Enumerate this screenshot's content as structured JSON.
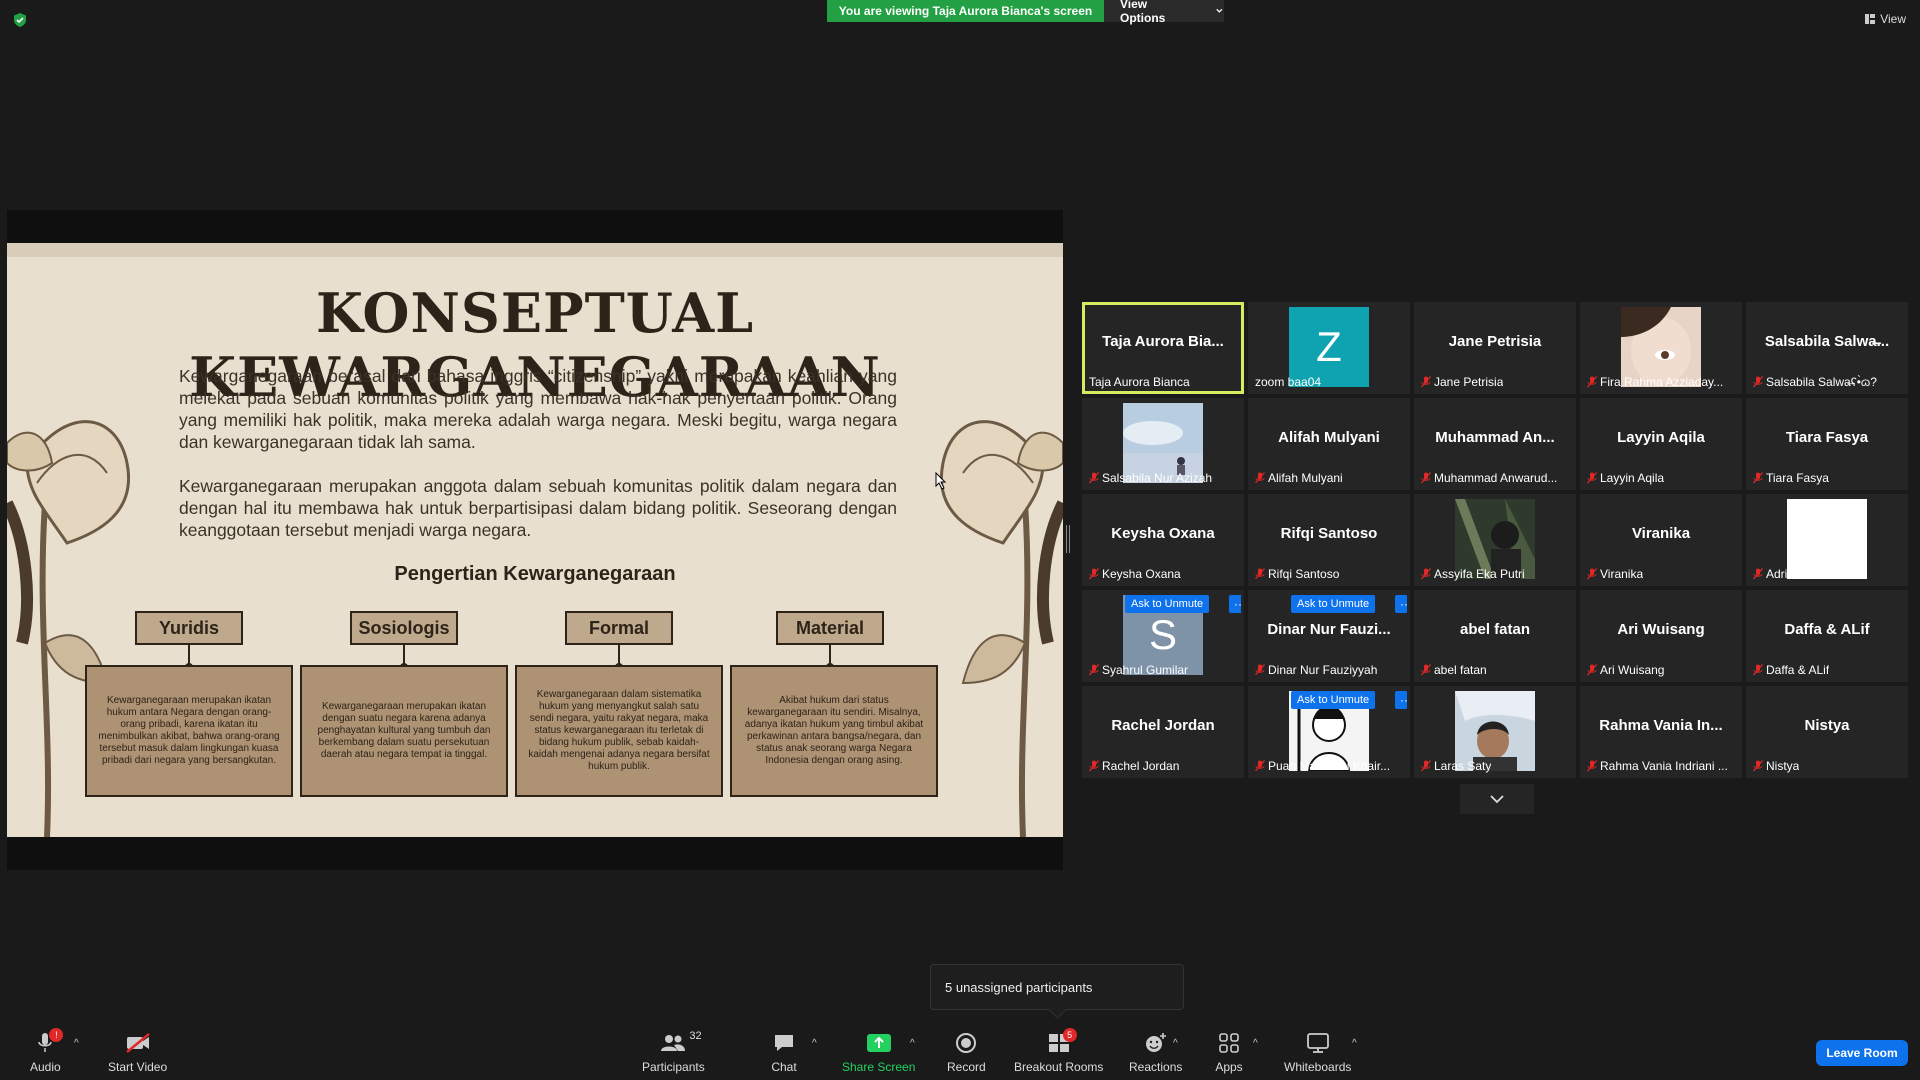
{
  "top_bar": {
    "viewing_banner": "You are viewing Taja Aurora Bianca's screen",
    "view_options": "View Options",
    "view": "View"
  },
  "slide": {
    "title": "KONSEPTUAL KEWARGANEGARAAN",
    "para1": "Kewarganegaraan berasal dari bahasa inggris “citizenship” yakni merupakan keahlian yang melekat pada sebuah komunitas politik yang membawa hak-hak penyertaan politik. Orang yang memiliki hak politik, maka mereka adalah warga negara. Meski begitu, warga negara dan kewarganegaraan tidak lah sama.",
    "para2": "Kewarganegaraan merupakan anggota dalam sebuah komunitas politik dalam negara dan dengan hal itu membawa hak untuk berpartisipasi dalam bidang politik. Seseorang dengan keanggotaan tersebut menjadi warga negara.",
    "subtitle": "Pengertian Kewarganegaraan",
    "concepts": [
      {
        "label": "Yuridis",
        "text": "Kewarganegaraan merupakan ikatan hukum antara Negara dengan orang-orang pribadi, karena ikatan itu menimbulkan akibat, bahwa orang-orang tersebut masuk dalam lingkungan kuasa pribadi dari negara yang bersangkutan."
      },
      {
        "label": "Sosiologis",
        "text": "Kewarganegaraan merupakan ikatan dengan suatu negara karena adanya penghayatan kultural yang tumbuh dan berkembang dalam suatu persekutuan daerah atau negara tempat ia tinggal."
      },
      {
        "label": "Formal",
        "text": "Kewarganegaraan dalam sistematika hukum yang menyangkut salah satu sendi negara, yaitu rakyat negara, maka status kewarganegaraan itu terletak di bidang hukum publik, sebab kaidah-kaidah mengenai adanya negara bersifat hukum publik."
      },
      {
        "label": "Material",
        "text": "Akibat hukum dari status kewarganegaraan itu sendiri. Misalnya, adanya ikatan hukum yang timbul akibat perkawinan antara bangsa/negara, dan status anak seorang warga Negara Indonesia dengan orang asing."
      }
    ]
  },
  "gallery": {
    "ask_to_unmute": "Ask to Unmute",
    "more": "···",
    "participants": [
      {
        "center": "Taja Aurora Bia...",
        "label": "Taja Aurora Bianca",
        "muted": false,
        "active": true,
        "kind": "name"
      },
      {
        "center": "Z",
        "label": "zoom baa04",
        "muted": false,
        "kind": "letter",
        "color": "#0fa3b1"
      },
      {
        "center": "Jane Petrisia",
        "label": "Jane Petrisia",
        "muted": true,
        "kind": "name"
      },
      {
        "center": "",
        "label": "Fira Rahma Azziaday...",
        "muted": true,
        "kind": "photo-face"
      },
      {
        "center": "Salsabila  Salwa̶...",
        "label": "Salsabila Salwa̶ʕ•̀ɷ?",
        "muted": true,
        "kind": "name"
      },
      {
        "center": "",
        "label": "Salsabila Nur Azizah",
        "muted": true,
        "kind": "photo-sky"
      },
      {
        "center": "Alifah Mulyani",
        "label": "Alifah Mulyani",
        "muted": true,
        "kind": "name"
      },
      {
        "center": "Muhammad  An...",
        "label": "Muhammad Anwarud...",
        "muted": true,
        "kind": "name"
      },
      {
        "center": "Layyin Aqila",
        "label": "Layyin Aqila",
        "muted": true,
        "kind": "name"
      },
      {
        "center": "Tiara Fasya",
        "label": "Tiara Fasya",
        "muted": true,
        "kind": "name"
      },
      {
        "center": "Keysha Oxana",
        "label": "Keysha Oxana",
        "muted": true,
        "kind": "name"
      },
      {
        "center": "Rifqi Santoso",
        "label": "Rifqi Santoso",
        "muted": true,
        "kind": "name"
      },
      {
        "center": "",
        "label": "Assyifa Eka Putri",
        "muted": true,
        "kind": "photo-dark"
      },
      {
        "center": "Viranika",
        "label": "Viranika",
        "muted": true,
        "kind": "name"
      },
      {
        "center": "",
        "label": "Adrian Akbar",
        "muted": true,
        "kind": "photo-white"
      },
      {
        "center": "S",
        "label": "Syahrul Gumilar",
        "muted": true,
        "kind": "letter-ask",
        "color": "#7f93a8"
      },
      {
        "center": "Dinar  Nur  Fauzi...",
        "label": "Dinar Nur Fauziyyah",
        "muted": true,
        "kind": "name-ask"
      },
      {
        "center": "abel fatan",
        "label": "abel fatan",
        "muted": true,
        "kind": "name"
      },
      {
        "center": "Ari Wuisang",
        "label": "Ari Wuisang",
        "muted": true,
        "kind": "name"
      },
      {
        "center": "Daffa & ALif",
        "label": "Daffa & ALif",
        "muted": true,
        "kind": "name"
      },
      {
        "center": "Rachel Jordan",
        "label": "Rachel Jordan",
        "muted": true,
        "kind": "name"
      },
      {
        "center": "",
        "label": "Puan Maharani Khair...",
        "muted": true,
        "kind": "photo-manga-ask"
      },
      {
        "center": "",
        "label": "Laras Saty",
        "muted": true,
        "kind": "photo-selfie"
      },
      {
        "center": "Rahma  Vania  In...",
        "label": "Rahma Vania Indriani ...",
        "muted": true,
        "kind": "name"
      },
      {
        "center": "Nistya",
        "label": "Nistya",
        "muted": true,
        "kind": "name"
      }
    ]
  },
  "popup": {
    "unassigned": "5 unassigned participants"
  },
  "toolbar": {
    "audio": "Audio",
    "audio_badge": "!",
    "start_video": "Start Video",
    "participants": "Participants",
    "participants_count": "32",
    "chat": "Chat",
    "share_screen": "Share Screen",
    "record": "Record",
    "breakout_rooms": "Breakout Rooms",
    "breakout_badge": "5",
    "reactions": "Reactions",
    "apps": "Apps",
    "whiteboards": "Whiteboards",
    "leave_room": "Leave Room"
  },
  "colors": {
    "accent_green": "#23a043",
    "active_border": "#d4ed5e",
    "brand_blue": "#0e72ed",
    "muted_red": "#e02828"
  }
}
